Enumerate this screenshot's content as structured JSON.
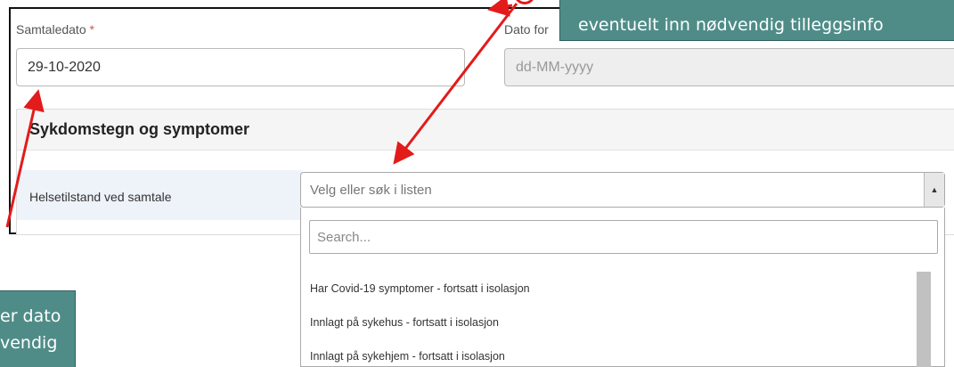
{
  "form": {
    "date_label": "Samtaledato",
    "required_marker": "*",
    "date_value": "29-10-2020",
    "other_date_label": "Dato for",
    "other_date_placeholder": "dd-MM-yyyy"
  },
  "panel": {
    "title": "Sykdomstegn og symptomer",
    "row_label": "Helsetilstand ved samtale",
    "select_placeholder": "Velg eller søk i listen",
    "search_placeholder": "Search...",
    "options": [
      "Har Covid-19 symptomer - fortsatt i isolasjon",
      "Innlagt på sykehus - fortsatt i isolasjon",
      "Innlagt på sykehjem - fortsatt i isolasjon"
    ]
  },
  "callouts": {
    "top_line2": "eventuelt inn nødvendig tilleggsinfo",
    "left_line1": "er dato",
    "left_line2": "vendig"
  },
  "colors": {
    "callout_bg": "#4f8c88",
    "annotation_red": "#e31b1b",
    "required_star": "#d9534f"
  },
  "icons": {
    "dropdown_arrow": "triangle-up-icon"
  }
}
